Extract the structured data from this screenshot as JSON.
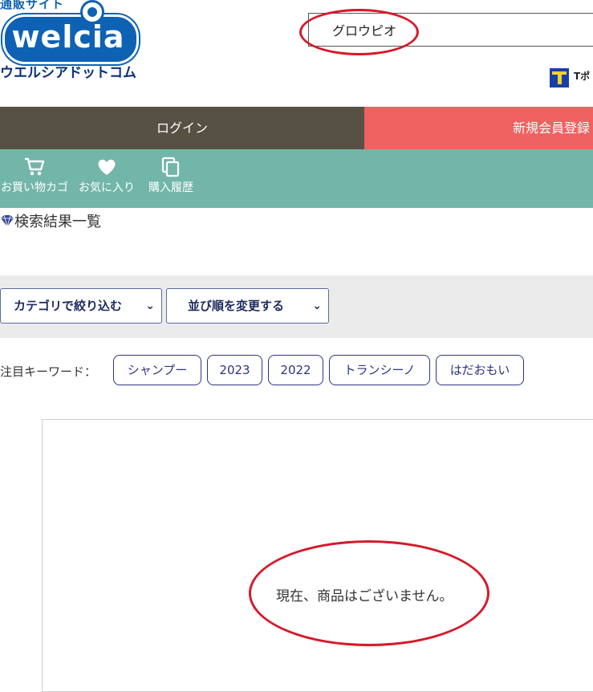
{
  "logo": {
    "tagline": "通販サイト",
    "wordmark": "welcia",
    "kana": "ウエルシアドットコム",
    "brand_color": "#0e62b3"
  },
  "search": {
    "value": "グロウピオ"
  },
  "tpoint": {
    "label": "Tポ"
  },
  "auth": {
    "login_label": "ログイン",
    "register_label": "新規会員登録",
    "login_color": "#565143",
    "register_color": "#f06161"
  },
  "nav": {
    "color": "#72b6a9",
    "items": [
      {
        "label": "お買い物カゴ",
        "icon": "cart-icon"
      },
      {
        "label": "お気に入り",
        "icon": "heart-icon"
      },
      {
        "label": "購入履歴",
        "icon": "copy-icon"
      }
    ]
  },
  "results": {
    "title": "検索結果一覧",
    "icon": "diamond-icon",
    "empty_message": "現在、商品はございません。"
  },
  "filters": {
    "category_label": "カテゴリで絞り込む",
    "sort_label": "並び順を変更する",
    "chevron_icon": "chevron-down-icon"
  },
  "keywords": {
    "label": "注目キーワード：",
    "items": [
      "シャンプー",
      "2023",
      "2022",
      "トランシーノ",
      "はだおもい"
    ]
  },
  "annotation_color": "#d6192a"
}
